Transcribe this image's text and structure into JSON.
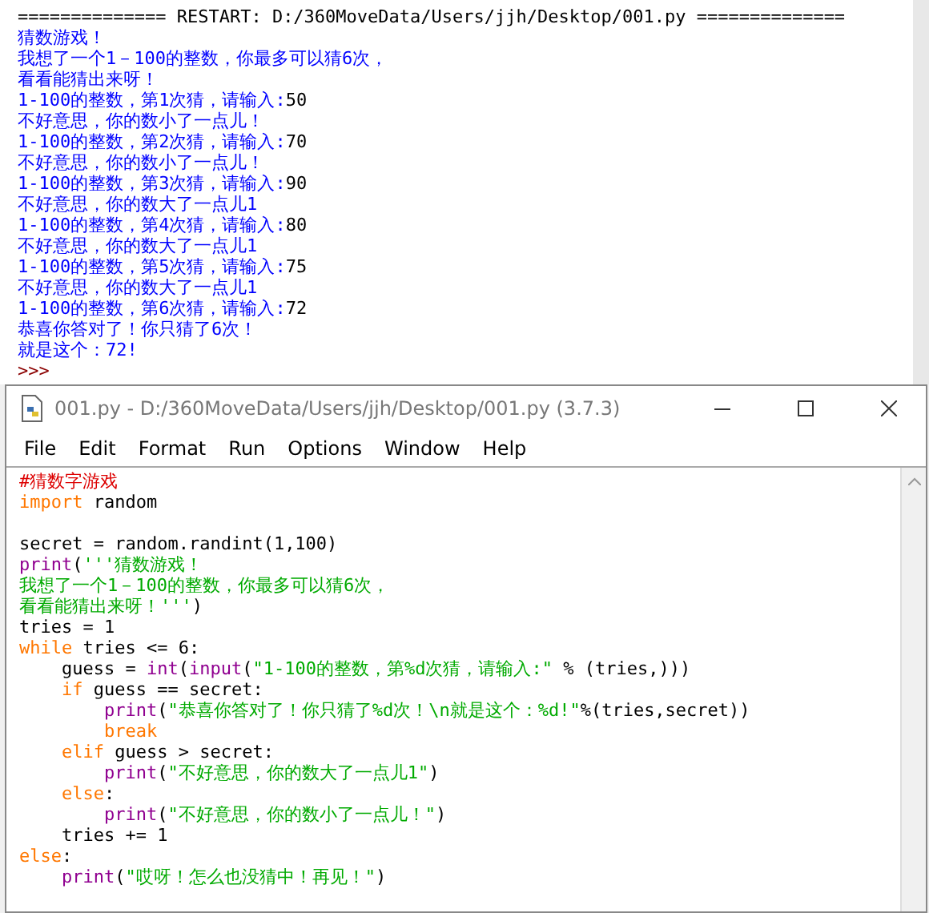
{
  "shell": {
    "lines": [
      [
        {
          "kind": "normal",
          "text": "============== RESTART: D:/360MoveData/Users/jjh/Desktop/001.py =============="
        }
      ],
      [
        {
          "kind": "output",
          "text": "猜数游戏！"
        }
      ],
      [
        {
          "kind": "output",
          "text": "我想了一个1－100的整数，你最多可以猜6次，"
        }
      ],
      [
        {
          "kind": "output",
          "text": "看看能猜出来呀！"
        }
      ],
      [
        {
          "kind": "output",
          "text": "1-100的整数，第1次猜，请输入:"
        },
        {
          "kind": "input",
          "text": "50"
        }
      ],
      [
        {
          "kind": "output",
          "text": "不好意思，你的数小了一点儿！"
        }
      ],
      [
        {
          "kind": "output",
          "text": "1-100的整数，第2次猜，请输入:"
        },
        {
          "kind": "input",
          "text": "70"
        }
      ],
      [
        {
          "kind": "output",
          "text": "不好意思，你的数小了一点儿！"
        }
      ],
      [
        {
          "kind": "output",
          "text": "1-100的整数，第3次猜，请输入:"
        },
        {
          "kind": "input",
          "text": "90"
        }
      ],
      [
        {
          "kind": "output",
          "text": "不好意思，你的数大了一点儿1"
        }
      ],
      [
        {
          "kind": "output",
          "text": "1-100的整数，第4次猜，请输入:"
        },
        {
          "kind": "input",
          "text": "80"
        }
      ],
      [
        {
          "kind": "output",
          "text": "不好意思，你的数大了一点儿1"
        }
      ],
      [
        {
          "kind": "output",
          "text": "1-100的整数，第5次猜，请输入:"
        },
        {
          "kind": "input",
          "text": "75"
        }
      ],
      [
        {
          "kind": "output",
          "text": "不好意思，你的数大了一点儿1"
        }
      ],
      [
        {
          "kind": "output",
          "text": "1-100的整数，第6次猜，请输入:"
        },
        {
          "kind": "input",
          "text": "72"
        }
      ],
      [
        {
          "kind": "output",
          "text": "恭喜你答对了！你只猜了6次！"
        }
      ],
      [
        {
          "kind": "output",
          "text": "就是这个：72!"
        }
      ],
      [
        {
          "kind": "prompt",
          "text": ">>>"
        }
      ]
    ]
  },
  "editor": {
    "title": "001.py - D:/360MoveData/Users/jjh/Desktop/001.py (3.7.3)",
    "menu": [
      {
        "label": "File"
      },
      {
        "label": "Edit"
      },
      {
        "label": "Format"
      },
      {
        "label": "Run"
      },
      {
        "label": "Options"
      },
      {
        "label": "Window"
      },
      {
        "label": "Help"
      }
    ],
    "lines": [
      [
        {
          "kind": "comment",
          "text": "#猜数字游戏"
        }
      ],
      [
        {
          "kind": "keyword",
          "text": "import"
        },
        {
          "kind": "normal",
          "text": " random"
        }
      ],
      [
        {
          "kind": "blank"
        }
      ],
      [
        {
          "kind": "normal",
          "text": "secret = random.randint(1,100)"
        }
      ],
      [
        {
          "kind": "builtin",
          "text": "print"
        },
        {
          "kind": "normal",
          "text": "("
        },
        {
          "kind": "string",
          "text": "'''猜数游戏！"
        }
      ],
      [
        {
          "kind": "string",
          "text": "我想了一个1－100的整数，你最多可以猜6次，"
        }
      ],
      [
        {
          "kind": "string",
          "text": "看看能猜出来呀！'''"
        },
        {
          "kind": "normal",
          "text": ")"
        }
      ],
      [
        {
          "kind": "normal",
          "text": "tries = 1"
        }
      ],
      [
        {
          "kind": "keyword",
          "text": "while"
        },
        {
          "kind": "normal",
          "text": " tries <= 6:"
        }
      ],
      [
        {
          "kind": "normal",
          "text": "    guess = "
        },
        {
          "kind": "builtin",
          "text": "int"
        },
        {
          "kind": "normal",
          "text": "("
        },
        {
          "kind": "builtin",
          "text": "input"
        },
        {
          "kind": "normal",
          "text": "("
        },
        {
          "kind": "string",
          "text": "\"1-100的整数，第%d次猜，请输入:\""
        },
        {
          "kind": "normal",
          "text": " % (tries,)))"
        }
      ],
      [
        {
          "kind": "keyword",
          "text": "    if"
        },
        {
          "kind": "normal",
          "text": " guess == secret:"
        }
      ],
      [
        {
          "kind": "builtin",
          "text": "        print"
        },
        {
          "kind": "normal",
          "text": "("
        },
        {
          "kind": "string",
          "text": "\"恭喜你答对了！你只猜了%d次！\\n就是这个：%d!\""
        },
        {
          "kind": "normal",
          "text": "%(tries,secret))"
        }
      ],
      [
        {
          "kind": "keyword",
          "text": "        break"
        }
      ],
      [
        {
          "kind": "keyword",
          "text": "    elif"
        },
        {
          "kind": "normal",
          "text": " guess > secret:"
        }
      ],
      [
        {
          "kind": "builtin",
          "text": "        print"
        },
        {
          "kind": "normal",
          "text": "("
        },
        {
          "kind": "string",
          "text": "\"不好意思，你的数大了一点儿1\""
        },
        {
          "kind": "normal",
          "text": ")"
        }
      ],
      [
        {
          "kind": "keyword",
          "text": "    else"
        },
        {
          "kind": "normal",
          "text": ":"
        }
      ],
      [
        {
          "kind": "builtin",
          "text": "        print"
        },
        {
          "kind": "normal",
          "text": "("
        },
        {
          "kind": "string",
          "text": "\"不好意思，你的数小了一点儿！\""
        },
        {
          "kind": "normal",
          "text": ")"
        }
      ],
      [
        {
          "kind": "normal",
          "text": "    tries += 1"
        }
      ],
      [
        {
          "kind": "keyword",
          "text": "else"
        },
        {
          "kind": "normal",
          "text": ":"
        }
      ],
      [
        {
          "kind": "builtin",
          "text": "    print"
        },
        {
          "kind": "normal",
          "text": "("
        },
        {
          "kind": "string",
          "text": "\"哎呀！怎么也没猜中！再见！\""
        },
        {
          "kind": "normal",
          "text": ")"
        }
      ]
    ]
  }
}
